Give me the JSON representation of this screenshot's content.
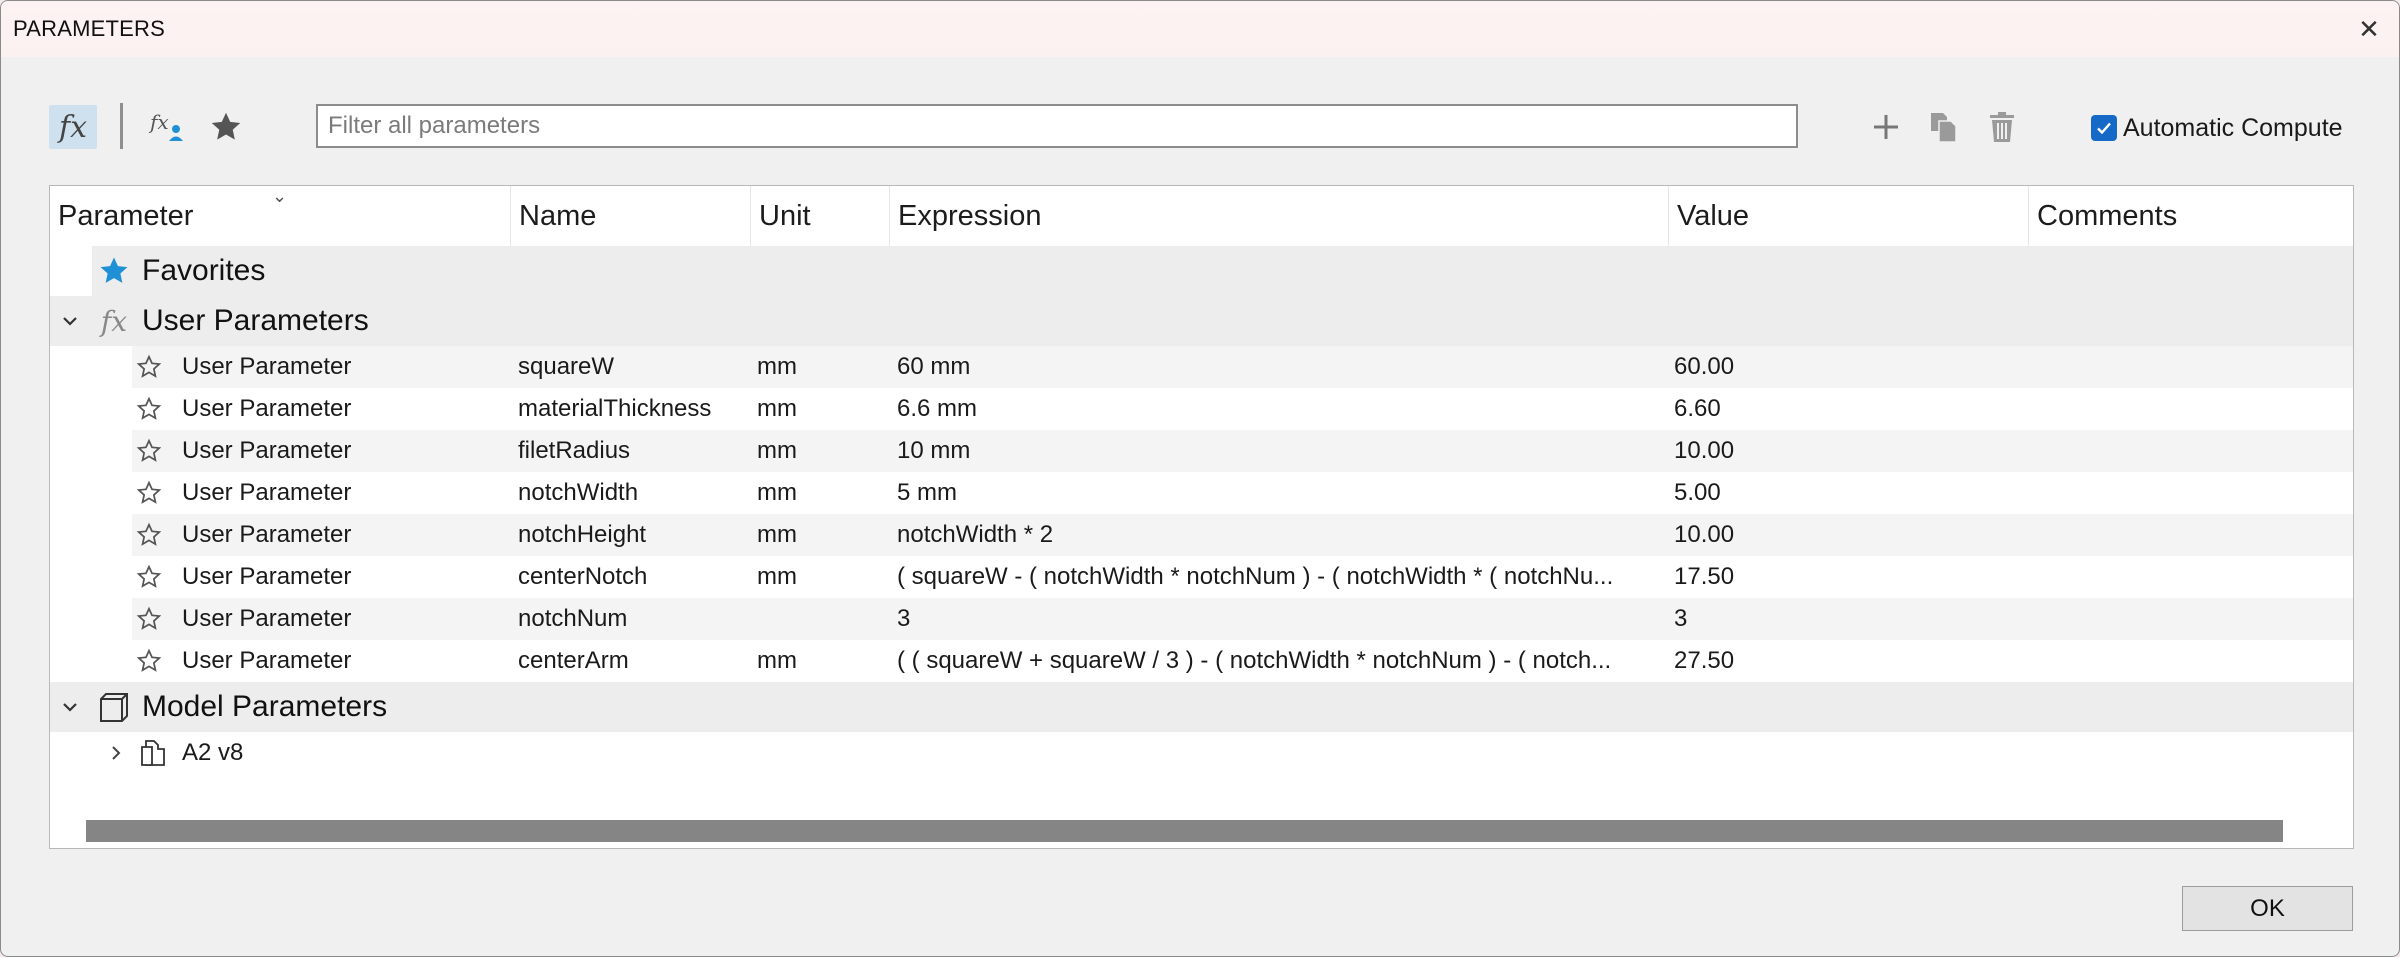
{
  "window": {
    "title": "PARAMETERS",
    "close_glyph": "✕"
  },
  "toolbar": {
    "fx_label": "fx",
    "filter_placeholder": "Filter all parameters",
    "automatic_compute_label": "Automatic Compute",
    "automatic_compute_checked": true,
    "icons": [
      "fx-icon",
      "fx-user-icon",
      "star-icon",
      "plus-icon",
      "copy-icon",
      "trash-icon"
    ]
  },
  "table": {
    "columns": [
      "Parameter",
      "Name",
      "Unit",
      "Expression",
      "Value",
      "Comments"
    ],
    "favorites_label": "Favorites",
    "user_parameters_label": "User Parameters",
    "model_parameters_label": "Model Parameters",
    "rows": [
      {
        "param": "User Parameter",
        "name": "squareW",
        "unit": "mm",
        "expression": "60 mm",
        "value": "60.00",
        "comment": ""
      },
      {
        "param": "User Parameter",
        "name": "materialThickness",
        "unit": "mm",
        "expression": "6.6 mm",
        "value": "6.60",
        "comment": ""
      },
      {
        "param": "User Parameter",
        "name": "filetRadius",
        "unit": "mm",
        "expression": "10 mm",
        "value": "10.00",
        "comment": ""
      },
      {
        "param": "User Parameter",
        "name": "notchWidth",
        "unit": "mm",
        "expression": "5 mm",
        "value": "5.00",
        "comment": ""
      },
      {
        "param": "User Parameter",
        "name": "notchHeight",
        "unit": "mm",
        "expression": "notchWidth * 2",
        "value": "10.00",
        "comment": ""
      },
      {
        "param": "User Parameter",
        "name": "centerNotch",
        "unit": "mm",
        "expression": "( squareW - ( notchWidth * notchNum ) - ( notchWidth * ( notchNu...",
        "value": "17.50",
        "comment": ""
      },
      {
        "param": "User Parameter",
        "name": "notchNum",
        "unit": "",
        "expression": "3",
        "value": "3",
        "comment": ""
      },
      {
        "param": "User Parameter",
        "name": "centerArm",
        "unit": "mm",
        "expression": "( ( squareW + squareW / 3 ) - ( notchWidth * notchNum ) - ( notch...",
        "value": "27.50",
        "comment": ""
      }
    ],
    "model_items": [
      {
        "label": "A2 v8"
      }
    ]
  },
  "footer": {
    "ok_label": "OK"
  },
  "colors": {
    "accent": "#1769c8",
    "star_fill": "#1f8fd6",
    "fx_button_bg": "#cfe0ee",
    "scrollbar": "#858585"
  }
}
